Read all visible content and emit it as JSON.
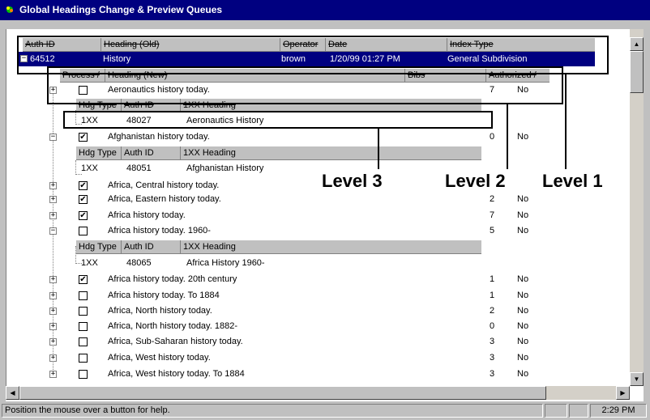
{
  "window": {
    "title": "Global Headings Change &  Preview Queues"
  },
  "level1_header": {
    "auth_id": "Auth ID",
    "heading_old": "Heading (Old)",
    "operator": "Operator",
    "date": "Date",
    "index_type": "Index Type"
  },
  "level1_row": {
    "expander": "−",
    "auth_id": "64512",
    "heading": "History",
    "operator": "brown",
    "date": "1/20/99 01:27 PM",
    "index_type": "General Subdivision"
  },
  "level2_header": {
    "process": "Process /",
    "heading_new": "Heading (New)",
    "bibs": "Bibs",
    "authorized": "Authorized /"
  },
  "level3_header": {
    "hdg_type": "Hdg Type",
    "auth_id": "Auth ID",
    "heading_1xx": "1XX Heading"
  },
  "rows": [
    {
      "expander": "+",
      "checked": false,
      "heading": "Aeronautics history today.",
      "bibs": "7",
      "authorized": "No"
    },
    {
      "expander": "−",
      "checked": true,
      "heading": "Afghanistan history today.",
      "bibs": "0",
      "authorized": "No"
    },
    {
      "expander": "+",
      "checked": true,
      "heading": "Africa, Central history today.",
      "bibs": "",
      "authorized": ""
    },
    {
      "expander": "+",
      "checked": true,
      "heading": "Africa, Eastern history today.",
      "bibs": "2",
      "authorized": "No"
    },
    {
      "expander": "+",
      "checked": true,
      "heading": "Africa history today.",
      "bibs": "7",
      "authorized": "No"
    },
    {
      "expander": "−",
      "checked": false,
      "heading": "Africa history today. 1960-",
      "bibs": "5",
      "authorized": "No"
    },
    {
      "expander": "+",
      "checked": true,
      "heading": "Africa history today. 20th century",
      "bibs": "1",
      "authorized": "No"
    },
    {
      "expander": "+",
      "checked": false,
      "heading": "Africa history today. To 1884",
      "bibs": "1",
      "authorized": "No"
    },
    {
      "expander": "+",
      "checked": false,
      "heading": "Africa, North history today.",
      "bibs": "2",
      "authorized": "No"
    },
    {
      "expander": "+",
      "checked": false,
      "heading": "Africa, North history today. 1882-",
      "bibs": "0",
      "authorized": "No"
    },
    {
      "expander": "+",
      "checked": false,
      "heading": "Africa, Sub-Saharan history today.",
      "bibs": "3",
      "authorized": "No"
    },
    {
      "expander": "+",
      "checked": false,
      "heading": "Africa, West history today.",
      "bibs": "3",
      "authorized": "No"
    },
    {
      "expander": "+",
      "checked": false,
      "heading": "Africa, West history today. To 1884",
      "bibs": "3",
      "authorized": "No"
    }
  ],
  "subrows": [
    {
      "hdg_type": "1XX",
      "auth_id": "48027",
      "heading": "Aeronautics History"
    },
    {
      "hdg_type": "1XX",
      "auth_id": "48051",
      "heading": "Afghanistan History"
    },
    {
      "hdg_type": "1XX",
      "auth_id": "48065",
      "heading": "Africa History 1960-"
    }
  ],
  "callouts": {
    "level1": "Level 1",
    "level2": "Level 2",
    "level3": "Level 3"
  },
  "status": {
    "message": "Position the mouse over a button for help.",
    "time": "2:29 PM"
  },
  "colors": {
    "title_bar": "#000080",
    "selection": "#000080",
    "chrome": "#c0c0c0"
  }
}
